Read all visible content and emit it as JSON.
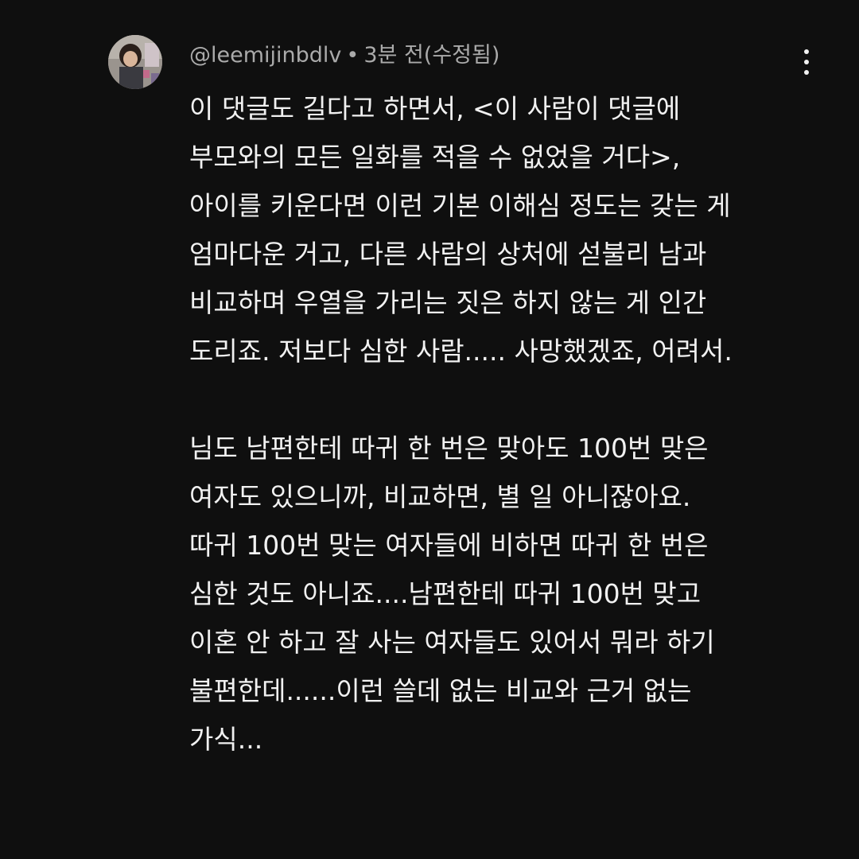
{
  "comment": {
    "author": "@leemijinbdlv",
    "separator": "•",
    "time": "3분 전(수정됨)",
    "avatar_icon": "profile-photo",
    "menu_icon": "more-vert-icon",
    "paragraphs": [
      [
        "이 댓글도 길다고 하면서, <이 사람이 댓글에",
        "부모와의 모든 일화를 적을 수 없었을 거다>,",
        "아이를 키운다면 이런 기본 이해심 정도는 갖는 게",
        "엄마다운 거고, 다른 사람의 상처에 섣불리 남과",
        "비교하며 우열을 가리는 짓은 하지 않는 게 인간",
        "도리죠. 저보다 심한 사람..... 사망했겠죠, 어려서."
      ],
      [
        "님도 남편한테 따귀 한 번은 맞아도 100번 맞은",
        "여자도 있으니까, 비교하면, 별 일 아니잖아요.",
        "따귀 100번 맞는 여자들에 비하면 따귀 한 번은",
        "심한 것도 아니죠....남편한테 따귀 100번 맞고",
        "이혼 안 하고 잘 사는 여자들도 있어서 뭐라 하기",
        "불편한데......이런 쓸데 없는 비교와 근거 없는",
        "가식..."
      ]
    ]
  }
}
